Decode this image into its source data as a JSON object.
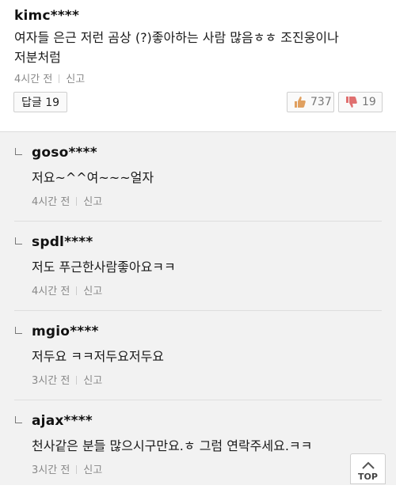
{
  "comment": {
    "author": "kimc****",
    "text_line1": "여자들 은근 저런 곰상 (?)좋아하는 사람 많음ㅎㅎ 조진웅이나",
    "text_line2": "저분처럼",
    "time": "4시간 전",
    "report": "신고",
    "reply_label": "답글 19",
    "likes": "737",
    "dislikes": "19"
  },
  "replies": [
    {
      "author": "goso****",
      "text": "저요~^^여~~~얼자",
      "time": "4시간 전",
      "report": "신고"
    },
    {
      "author": "spdl****",
      "text": "저도 푸근한사람좋아요ㅋㅋ",
      "time": "4시간 전",
      "report": "신고"
    },
    {
      "author": "mgio****",
      "text": "저두요 ㅋㅋ저두요저두요",
      "time": "3시간 전",
      "report": "신고"
    },
    {
      "author": "ajax****",
      "text": "천사같은 분들 많으시구만요.ㅎ 그럼 연락주세요.ㅋㅋ",
      "time": "3시간 전",
      "report": "신고"
    }
  ],
  "top_button": "TOP",
  "colors": {
    "reply_bg": "#f2f2f2",
    "like_icon": "#e0a060",
    "dislike_icon": "#e07070"
  },
  "icons": {
    "like": "thumbs-up-icon",
    "dislike": "thumbs-down-icon",
    "reply_arrow": "reply-arrow-icon",
    "top": "chevron-up-icon"
  }
}
